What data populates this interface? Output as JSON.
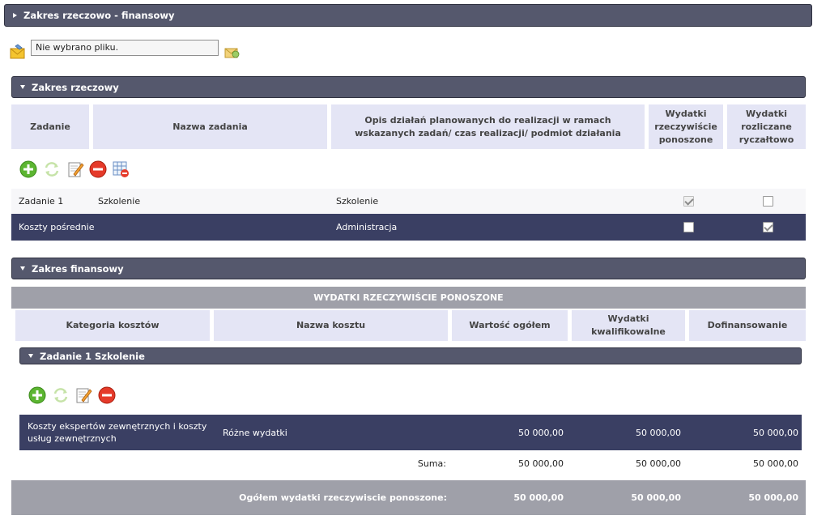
{
  "section_main": {
    "title": "Zakres rzeczowo - finansowy"
  },
  "file_upload": {
    "value": "Nie wybrano pliku."
  },
  "zakres_rzeczowy": {
    "title": "Zakres rzeczowy",
    "headers": {
      "zadanie": "Zadanie",
      "nazwa": "Nazwa zadania",
      "opis": "Opis działań planowanych do realizacji w ramach wskazanych zadań/ czas realizacji/ podmiot działania",
      "wydatki_rzecz": "Wydatki rzeczywiście ponoszone",
      "wydatki_rycz": "Wydatki rozliczane ryczałtowo"
    },
    "rows": [
      {
        "zadanie": "Zadanie 1",
        "nazwa": "Szkolenie",
        "opis": "Szkolenie",
        "rzecz_checked": true,
        "rycz_checked": false
      },
      {
        "zadanie": "Koszty pośrednie",
        "nazwa": "",
        "opis": "Administracja",
        "rzecz_checked": false,
        "rycz_checked": true
      }
    ]
  },
  "zakres_finansowy": {
    "title": "Zakres finansowy",
    "group_header": "WYDATKI RZECZYWIŚCIE PONOSZONE",
    "headers": {
      "kategoria": "Kategoria kosztów",
      "nazwa": "Nazwa kosztu",
      "wartosc": "Wartość ogółem",
      "kwalifikowalne": "Wydatki kwalifikowalne",
      "dofinansowanie": "Dofinansowanie"
    },
    "zadanie_title": "Zadanie 1 Szkolenie",
    "rows": [
      {
        "kategoria": "Koszty ekspertów zewnętrznych i koszty usług zewnętrznych",
        "nazwa": "Różne wydatki",
        "wartosc": "50 000,00",
        "kwalifikowalne": "50 000,00",
        "dofinansowanie": "50 000,00"
      }
    ],
    "suma": {
      "label": "Suma:",
      "wartosc": "50 000,00",
      "kwalifikowalne": "50 000,00",
      "dofinansowanie": "50 000,00"
    },
    "total": {
      "label": "Ogółem wydatki rzeczywiscie ponoszone:",
      "wartosc": "50 000,00",
      "kwalifikowalne": "50 000,00",
      "dofinansowanie": "50 000,00"
    }
  },
  "colors": {
    "bar": "#55586d",
    "header_cell": "#e4e5f5",
    "dark_row": "#3a3f63",
    "total_row": "#9fa0a9"
  },
  "icons": {
    "add": "plus-circle-icon",
    "refresh": "refresh-icon",
    "edit": "edit-note-icon",
    "remove": "minus-circle-icon",
    "table": "table-remove-icon",
    "file": "envelope-icon",
    "upload": "upload-icon"
  }
}
